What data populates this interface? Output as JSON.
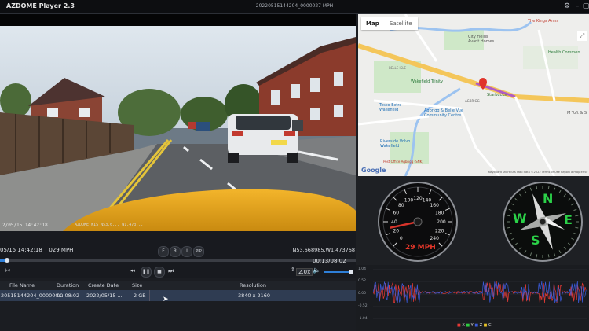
{
  "app": {
    "title": "AZDOME Player 2.3",
    "file_title": "20220515144204_0000027 MPH"
  },
  "video_osd": {
    "datetime": "2/05/15 14:42:18",
    "extra": "AZDOME WIS   N53.6...  W1.473..."
  },
  "controls": {
    "flags": [
      "F",
      "R",
      "I",
      "PIP"
    ],
    "timestamp": "05/15 14:42:18",
    "speed": "029 MPH",
    "coords": "N53.668985,W1.473768",
    "progress_fraction": 0.02,
    "time": "00:13/08:02",
    "playback_rate": "2.0x"
  },
  "table": {
    "headers": [
      "File Name",
      "Duration",
      "Create Date",
      "Size",
      "Resolution"
    ],
    "rows": [
      {
        "name": "20515144204_000000...",
        "duration": "00:08:02",
        "date": "2022/05/15 ...",
        "size": "2 GB",
        "resolution": "3840 x 2160"
      }
    ]
  },
  "map": {
    "tabs": [
      "Map",
      "Satellite"
    ],
    "labels": {
      "kings_arms": "The Kings Arms",
      "city_fields": "City Fields\nAvant Homes",
      "health": "Health Common",
      "wakefield_trinity": "Wakefield Trinity",
      "belle": "BELLE ISLE",
      "tesco": "Tesco Extra\nWakefield",
      "agbrigg": "Agbrigg & Belle Vue\nCommunity Centre",
      "riverside": "Riverside Volvo\nWakefield",
      "agbrigg_road": "AGBRIGG",
      "starbucks": "Starbucks",
      "mtoft": "M Toft & S",
      "post": "Post Office Agbrigg (SNK)",
      "google": "Google",
      "footer": "Keyboard shortcuts  Map data ©2022  Terms of Use  Report a map error"
    }
  },
  "speedometer": {
    "ticks": [
      "0",
      "20",
      "40",
      "60",
      "80",
      "100",
      "120",
      "140",
      "160",
      "180",
      "200",
      "220",
      "240"
    ],
    "readout": "29 MPH",
    "value": 29,
    "max": 240
  },
  "compass": {
    "letters": [
      "N",
      "E",
      "S",
      "W"
    ]
  },
  "chart_data": {
    "type": "line",
    "ylim": [
      -1.04,
      1.04
    ],
    "y_ticks": [
      "1.04",
      "0.52",
      "0.00",
      "-0.52",
      "-1.04"
    ],
    "legend": [
      "X",
      "Y",
      "Z",
      "C"
    ],
    "legend_colors": [
      "#e53935",
      "#2ecc40",
      "#3b5bdb",
      "#e6c229"
    ]
  }
}
